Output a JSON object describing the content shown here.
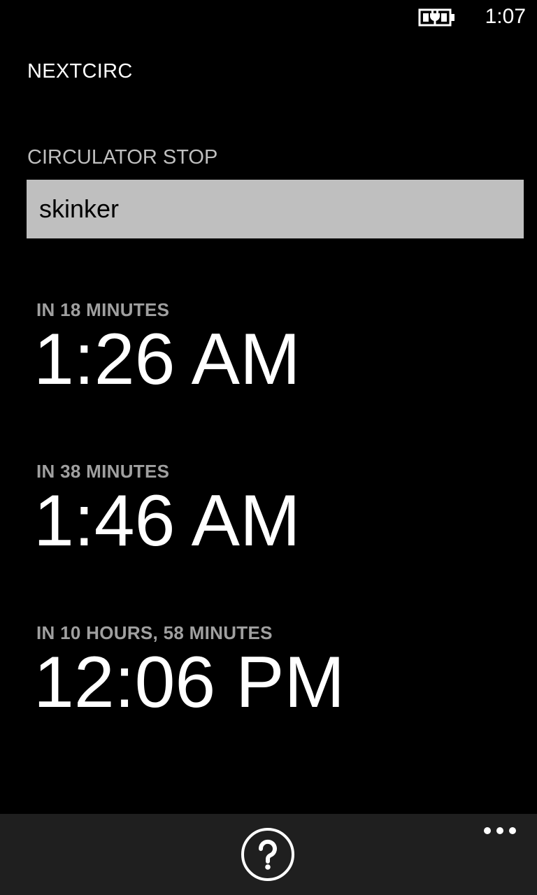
{
  "status_bar": {
    "time": "1:07",
    "battery_icon": "battery-charging-icon"
  },
  "app": {
    "title": "NEXTCIRC"
  },
  "stop_field": {
    "label": "CIRCULATOR STOP",
    "value": "skinker"
  },
  "arrivals": [
    {
      "relative": "IN 18 MINUTES",
      "time": "1:26 AM"
    },
    {
      "relative": "IN 38 MINUTES",
      "time": "1:46 AM"
    },
    {
      "relative": "IN 10 HOURS, 58 MINUTES",
      "time": "12:06 PM"
    }
  ],
  "app_bar": {
    "help_icon": "question-mark-icon",
    "more_icon": "ellipsis-icon",
    "background_color": "#1f1f1f"
  }
}
